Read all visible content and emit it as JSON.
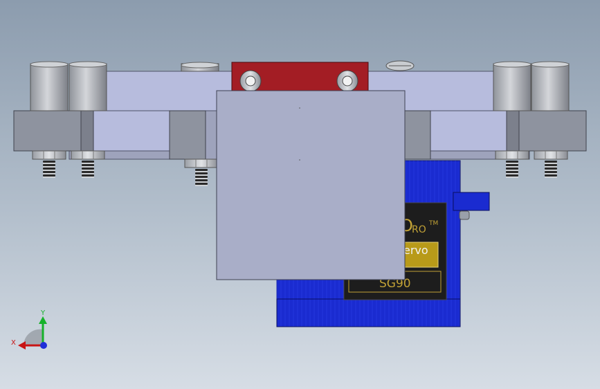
{
  "colors": {
    "background_top": "#8c9cae",
    "background_bottom": "#d6dde5",
    "plate": "#b7bcdd",
    "block": "#8e939f",
    "bracket_red": "#a31d24",
    "servo_blue": "#1a2bd0",
    "label_black": "#1d1d1d",
    "label_gold": "#b89a19",
    "front_panel": "#a9aec8"
  },
  "servo_label": {
    "brand_fragment": "O",
    "brand_suffix": "RO",
    "trademark": "TM",
    "line2": "ervo",
    "model": "SG90"
  },
  "triad": {
    "x_label": "X",
    "y_label": "Y",
    "x_color": "#c81414",
    "y_color": "#16b22a",
    "z_color": "#1f2fd8"
  }
}
